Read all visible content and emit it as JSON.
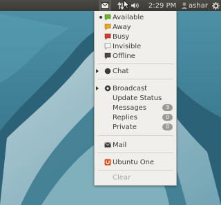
{
  "topbar": {
    "time": "2:29 PM",
    "user": "ashar",
    "icons": [
      "messaging-envelope-icon",
      "network-arrows-icon",
      "volume-icon",
      "power-gear-icon"
    ]
  },
  "menu": {
    "status": [
      {
        "label": "Available",
        "icon": "status-available-icon",
        "color": "#6cb52c",
        "selected": true
      },
      {
        "label": "Away",
        "icon": "status-away-icon",
        "color": "#e8a722",
        "selected": false
      },
      {
        "label": "Busy",
        "icon": "status-busy-icon",
        "color": "#d23b30",
        "selected": false
      },
      {
        "label": "Invisible",
        "icon": "status-invisible-icon",
        "color": "#8c8a84",
        "selected": false
      },
      {
        "label": "Offline",
        "icon": "status-offline-icon",
        "color": "#4a4944",
        "selected": false
      }
    ],
    "chat": "Chat",
    "broadcast": "Broadcast",
    "update_status": "Update Status",
    "messages": {
      "label": "Messages",
      "count": "3"
    },
    "replies": {
      "label": "Replies",
      "count": "0"
    },
    "private": {
      "label": "Private",
      "count": "0"
    },
    "mail": "Mail",
    "ubuntu_one": "Ubuntu One",
    "clear": "Clear"
  },
  "colors": {
    "panel": "#3b3a36",
    "menu_bg": "#f1efec",
    "accent_orange": "#dd4814"
  }
}
